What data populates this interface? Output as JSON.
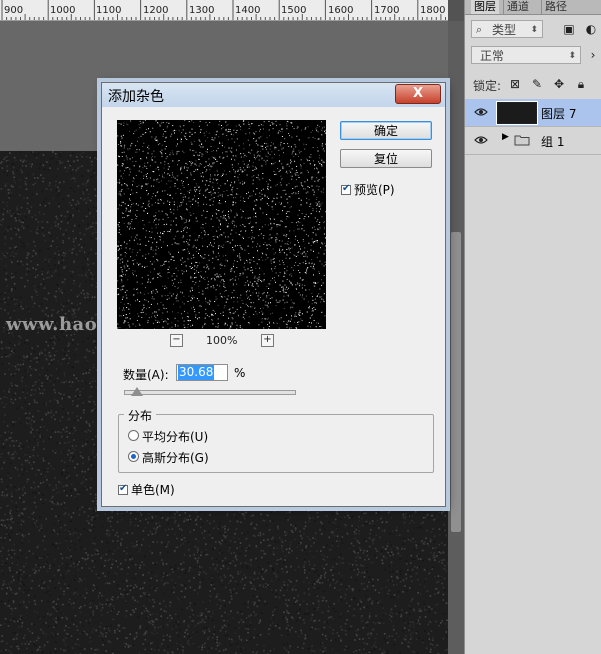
{
  "ruler": {
    "labels": [
      "900",
      "1000",
      "1100",
      "1200",
      "1300",
      "1400",
      "1500",
      "1600",
      "1700",
      "1800"
    ]
  },
  "watermark": "www.haoy_dianshoji.com",
  "panel": {
    "tabs": [
      "图层",
      "通道",
      "路径"
    ],
    "filter_kind": "类型",
    "blend_mode": "正常",
    "lock_label": "锁定:",
    "layers": [
      {
        "name": "图层 7",
        "selected": true
      },
      {
        "name": "组 1",
        "selected": false
      }
    ]
  },
  "dialog": {
    "title": "添加杂色",
    "close_label": "X",
    "ok_label": "确定",
    "reset_label": "复位",
    "preview_label": "预览(P)",
    "preview_checked": true,
    "zoom_out_label": "−",
    "zoom_in_label": "+",
    "zoom_level": "100%",
    "amount_label": "数量(A):",
    "amount_value": "30.68",
    "amount_unit": "%",
    "amount_fraction": 0.077,
    "distribution_label": "分布",
    "uniform_label": "平均分布(U)",
    "gaussian_label": "高斯分布(G)",
    "selected_distribution": "gaussian",
    "monochrome_label": "单色(M)",
    "monochrome_checked": true
  },
  "colors": {
    "selection_blue": "#aac4ee",
    "close_red": "#c7412c",
    "field_highlight": "#3399ff"
  }
}
